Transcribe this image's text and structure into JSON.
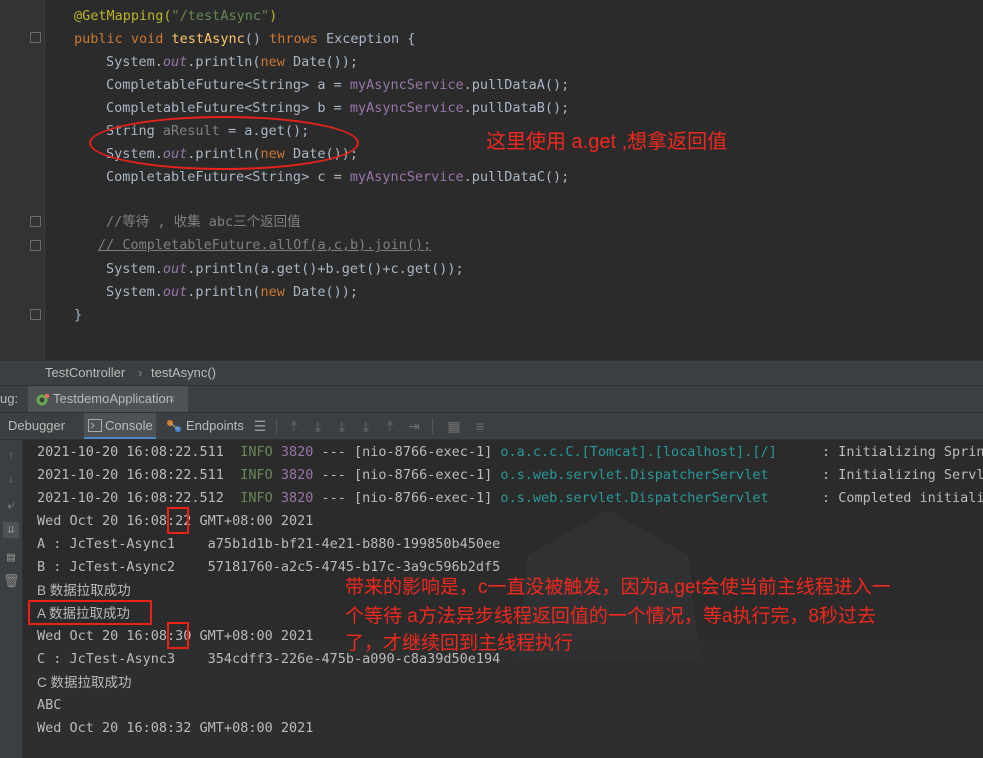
{
  "editor": {
    "lines": {
      "l0": {
        "ann": "@GetMapping(",
        "str": "\"/testAsync\"",
        "close": ")"
      },
      "l1": {
        "kw1": "public void ",
        "fn": "testAsync",
        "mid": "() ",
        "kw2": "throws ",
        "rest": "Exception {"
      },
      "l2": {
        "a": "System.",
        "fld": "out",
        "b": ".println(",
        "kw": "new ",
        "c": "Date());"
      },
      "l3": {
        "a": "CompletableFuture<String> a = ",
        "fld": "myAsyncService",
        "b": ".pullDataA();"
      },
      "l4": {
        "a": "CompletableFuture<String> b = ",
        "fld": "myAsyncService",
        "b": ".pullDataB();"
      },
      "l5": {
        "a": "String ",
        "var": "aResult",
        "b": " = a.get();"
      },
      "l6": {
        "a": "System.",
        "fld": "out",
        "b": ".println(",
        "kw": "new ",
        "c": "Date());"
      },
      "l7": {
        "a": "CompletableFuture<String> c = ",
        "fld": "myAsyncService",
        "b": ".pullDataC();"
      },
      "l8": {
        "cmt": "//等待 , 收集 abc三个返回值"
      },
      "l9": {
        "cmt": "// CompletableFuture.allOf(a,c,b).join();"
      },
      "l10": {
        "a": "System.",
        "fld": "out",
        "b": ".println(a.get()+b.get()+c.get());"
      },
      "l11": {
        "a": "System.",
        "fld": "out",
        "b": ".println(",
        "kw": "new ",
        "c": "Date());"
      },
      "l12": {
        "a": "}"
      }
    }
  },
  "breadcrumb": {
    "class_name": "TestController",
    "separator": "›",
    "method_name": "testAsync()"
  },
  "debug_bar": {
    "label": "ug:",
    "session": "TestdemoApplication",
    "close": "×"
  },
  "toolbar": {
    "debugger": "Debugger",
    "console": "Console",
    "endpoints": "Endpoints"
  },
  "console": {
    "log1": {
      "ts": "2021-10-20 16:08:22.511",
      "level": "INFO",
      "pid": "3820",
      "sep": "---",
      "thread": "[nio-8766-exec-1]",
      "logger": "o.a.c.c.C.[Tomcat].[localhost].[/]",
      "msg": ": Initializing Spring"
    },
    "log2": {
      "ts": "2021-10-20 16:08:22.511",
      "level": "INFO",
      "pid": "3820",
      "sep": "---",
      "thread": "[nio-8766-exec-1]",
      "logger": "o.s.web.servlet.DispatcherServlet",
      "msg": ": Initializing Servle"
    },
    "log3": {
      "ts": "2021-10-20 16:08:22.512",
      "level": "INFO",
      "pid": "3820",
      "sep": "---",
      "thread": "[nio-8766-exec-1]",
      "logger": "o.s.web.servlet.DispatcherServlet",
      "msg": ": Completed initiali"
    },
    "out1": "Wed Oct 20 16:08:22 GMT+08:00 2021",
    "out2": "A : JcTest-Async1    a75b1d1b-bf21-4e21-b880-199850b450ee",
    "out3": "B : JcTest-Async2    57181760-a2c5-4745-b17c-3a9c596b2df5",
    "out4": "B 数据拉取成功",
    "out5": "A 数据拉取成功",
    "out6": "Wed Oct 20 16:08:30 GMT+08:00 2021",
    "out7": "C : JcTest-Async3    354cdff3-226e-475b-a090-c8a39d50e194",
    "out8": "C 数据拉取成功",
    "out9": "ABC",
    "out10": "Wed Oct 20 16:08:32 GMT+08:00 2021"
  },
  "annotations": {
    "note_top": "这里使用 a.get ,想拿返回值",
    "note_bottom_1": "带来的影响是，c一直没被触发，因为a.get会使当前主线程进入一",
    "note_bottom_2": "个等待 a方法异步线程返回值的一个情况，等a执行完，8秒过去",
    "note_bottom_3": "了，才继续回到主线程执行"
  },
  "colors": {
    "accent_red": "#e8221b",
    "keyword": "#cc7832",
    "string": "#6a8759",
    "field": "#9876aa",
    "method": "#ffc66d"
  }
}
